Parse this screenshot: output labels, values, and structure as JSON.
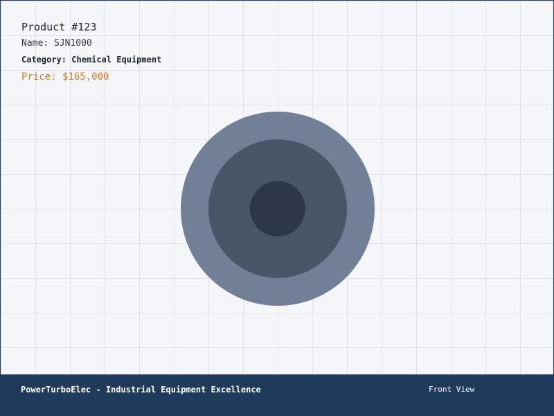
{
  "product": {
    "title": "Product #123",
    "name_line": "Name: SJN1000",
    "category_line": "Category: Chemical Equipment",
    "price_line": "Price: $165,000"
  },
  "view": {
    "rings": {
      "outer_color": "#718096",
      "middle_color": "#4a5568",
      "inner_color": "#2d3748"
    }
  },
  "footer": {
    "brand": "PowerTurboElec - Industrial Equipment Excellence",
    "view_label": "Front View"
  },
  "colors": {
    "footer_bg": "#1f3a5a",
    "price": "#d77a1e",
    "grid": "#dfe2e8",
    "background": "#f5f6fa"
  }
}
